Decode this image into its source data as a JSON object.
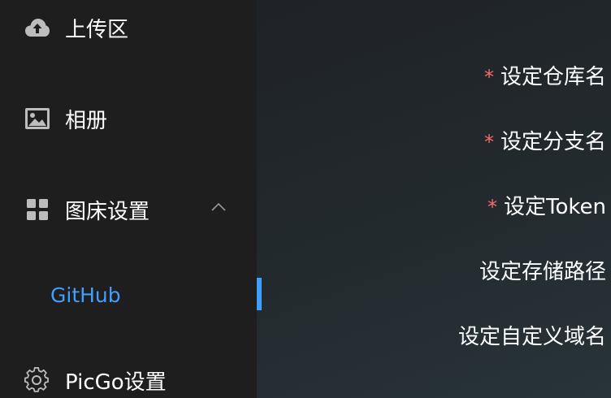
{
  "sidebar": {
    "items": [
      {
        "label": "上传区",
        "icon": "cloud-upload-icon"
      },
      {
        "label": "相册",
        "icon": "image-icon"
      },
      {
        "label": "图床设置",
        "icon": "grid-icon",
        "expanded": true
      },
      {
        "label": "PicGo设置",
        "icon": "gear-icon"
      }
    ],
    "sub_items": [
      {
        "label": "GitHub",
        "active": true
      }
    ]
  },
  "form": {
    "required_mark": "*",
    "labels": [
      {
        "text": "设定仓库名",
        "required": true
      },
      {
        "text": "设定分支名",
        "required": true
      },
      {
        "text": "设定Token",
        "required": true
      },
      {
        "text": "设定存储路径",
        "required": false
      },
      {
        "text": "设定自定义域名",
        "required": false
      }
    ]
  },
  "colors": {
    "sidebar_bg": "#1e1e1e",
    "accent": "#409eff",
    "required": "#f56c6c",
    "text": "#ffffff"
  }
}
